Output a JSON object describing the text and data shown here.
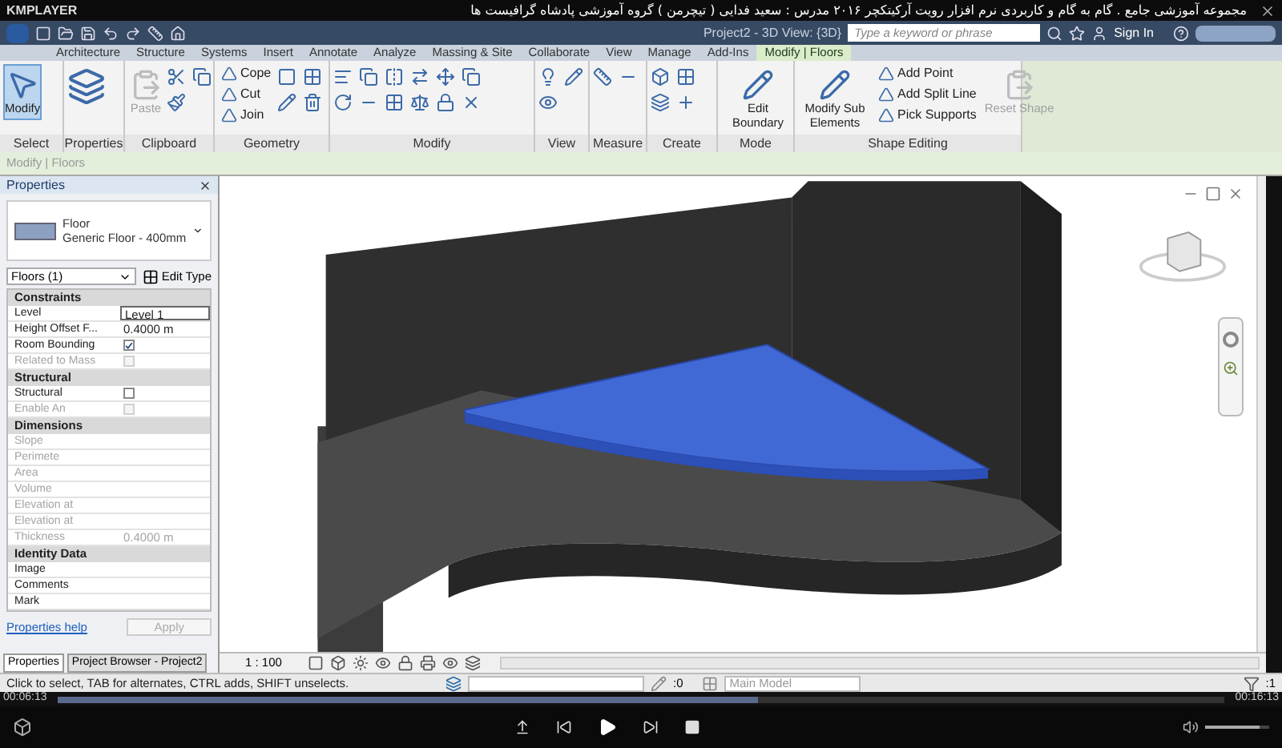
{
  "player": {
    "brand": "KMPLAYER",
    "title": "مجموعه آموزشی جامع . گام به گام و کاربردی نرم افزار رویت آرکیتکچر ۲۰۱۶   مدرس : سعید فدایی ( تیچرمن ) گروه آموزشی پادشاه گرافیست ها",
    "time_elapsed": "00:06:13",
    "time_total": "00:16:13",
    "progress": {
      "level": 0.6
    },
    "volume": {
      "level": 0.85
    }
  },
  "app": {
    "title": "Project2 - 3D View: {3D}",
    "search": {
      "placeholder": "Type a keyword or phrase"
    },
    "sign_in": "Sign In"
  },
  "tabs": [
    {
      "label": "Architecture",
      "selected": false
    },
    {
      "label": "Structure",
      "selected": false
    },
    {
      "label": "Systems",
      "selected": false
    },
    {
      "label": "Insert",
      "selected": false
    },
    {
      "label": "Annotate",
      "selected": false
    },
    {
      "label": "Analyze",
      "selected": false
    },
    {
      "label": "Massing & Site",
      "selected": false
    },
    {
      "label": "Collaborate",
      "selected": false
    },
    {
      "label": "View",
      "selected": false
    },
    {
      "label": "Manage",
      "selected": false
    },
    {
      "label": "Add-Ins",
      "selected": false
    },
    {
      "label": "Modify | Floors",
      "selected": true
    }
  ],
  "ribbon_panels": [
    {
      "title": "Select",
      "items": [
        {
          "kind": "large",
          "label": "Modify",
          "selected": true,
          "disabled": false
        }
      ]
    },
    {
      "title": "Properties"
    },
    {
      "title": "Clipboard",
      "items": [
        {
          "kind": "large",
          "label": "Paste",
          "selected": false,
          "disabled": true
        }
      ]
    },
    {
      "title": "Geometry",
      "items": [
        {
          "kind": "small",
          "label": "Cope",
          "selected": false,
          "disabled": false
        },
        {
          "kind": "small",
          "label": "Cut",
          "selected": false,
          "disabled": false
        },
        {
          "kind": "small",
          "label": "Join",
          "selected": false,
          "disabled": false
        }
      ]
    },
    {
      "title": "Modify"
    },
    {
      "title": "View"
    },
    {
      "title": "Measure"
    },
    {
      "title": "Create"
    },
    {
      "title": "Mode",
      "items": [
        {
          "kind": "large",
          "label": "Edit Boundary",
          "selected": false,
          "disabled": false
        }
      ]
    },
    {
      "title": "Shape Editing",
      "items": [
        {
          "kind": "large",
          "label": "Modify Sub Elements",
          "selected": false,
          "disabled": false
        },
        {
          "kind": "small",
          "label": "Add Point",
          "selected": false,
          "disabled": false
        },
        {
          "kind": "small",
          "label": "Add Split Line",
          "selected": false,
          "disabled": false
        },
        {
          "kind": "small",
          "label": "Pick Supports",
          "selected": false,
          "disabled": false
        },
        {
          "kind": "large",
          "label": "Reset Shape",
          "selected": false,
          "disabled": true
        }
      ]
    }
  ],
  "options_bar": {
    "label": "Modify | Floors"
  },
  "properties": {
    "title": "Properties",
    "type_name": "Floor",
    "type_value": "Generic Floor - 400mm",
    "filter": "Floors (1)",
    "edit_type": "Edit Type",
    "rows": [
      {
        "kind": "group",
        "label": "Constraints"
      },
      {
        "kind": "text",
        "label": "Level",
        "value": "Level 1",
        "disabled": false
      },
      {
        "kind": "text",
        "label": "Height Offset F...",
        "value": "0.4000 m",
        "disabled": false
      },
      {
        "kind": "check",
        "label": "Room Bounding",
        "checked": true,
        "disabled": false
      },
      {
        "kind": "check",
        "label": "Related to Mass",
        "checked": false,
        "disabled": true
      },
      {
        "kind": "group",
        "label": "Structural"
      },
      {
        "kind": "check",
        "label": "Structural",
        "checked": false,
        "disabled": false
      },
      {
        "kind": "check",
        "label": "Enable An",
        "checked": false,
        "disabled": true
      },
      {
        "kind": "group",
        "label": "Dimensions"
      },
      {
        "kind": "text",
        "label": "Slope",
        "value": "",
        "disabled": true
      },
      {
        "kind": "text",
        "label": "Perimete",
        "value": "",
        "disabled": true
      },
      {
        "kind": "text",
        "label": "Area",
        "value": "",
        "disabled": true
      },
      {
        "kind": "text",
        "label": "Volume",
        "value": "",
        "disabled": true
      },
      {
        "kind": "text",
        "label": "Elevation at",
        "value": "",
        "disabled": true
      },
      {
        "kind": "text",
        "label": "Elevation at",
        "value": "",
        "disabled": true
      },
      {
        "kind": "text",
        "label": "Thickness",
        "value": "0.4000 m",
        "disabled": true
      },
      {
        "kind": "group",
        "label": "Identity Data"
      },
      {
        "kind": "text",
        "label": "Image",
        "value": "",
        "disabled": false
      },
      {
        "kind": "text",
        "label": "Comments",
        "value": "",
        "disabled": false
      },
      {
        "kind": "text",
        "label": "Mark",
        "value": "",
        "disabled": false
      }
    ],
    "help_link": "Properties help",
    "apply": "Apply",
    "tabs": [
      {
        "label": "Properties",
        "selected": true
      },
      {
        "label": "Project Browser - Project2",
        "selected": false
      }
    ]
  },
  "view_bar": {
    "scale": "1 : 100"
  },
  "status_bar": {
    "message": "Click to select, TAB for alternates, CTRL adds, SHIFT unselects.",
    "count": ":0",
    "model": "Main Model",
    "filter_count": ":1"
  }
}
